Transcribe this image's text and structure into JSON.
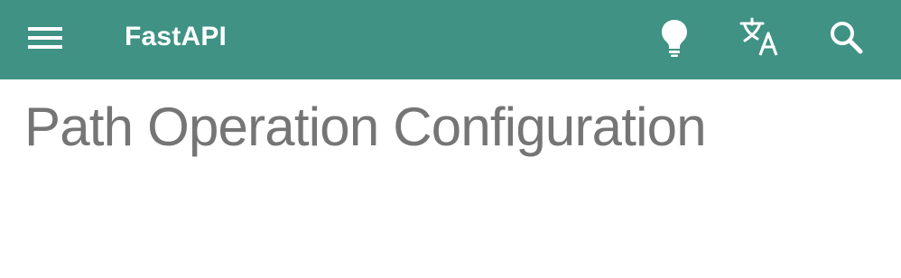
{
  "header": {
    "title": "FastAPI",
    "background_color": "#3f9284",
    "menu_icon": "menu-icon",
    "actions": [
      {
        "name": "palette-toggle",
        "icon": "lightbulb-icon"
      },
      {
        "name": "language-selector",
        "icon": "translate-icon"
      },
      {
        "name": "search",
        "icon": "search-icon"
      }
    ]
  },
  "main": {
    "page_title": "Path Operation Configuration",
    "title_color": "#757575"
  }
}
